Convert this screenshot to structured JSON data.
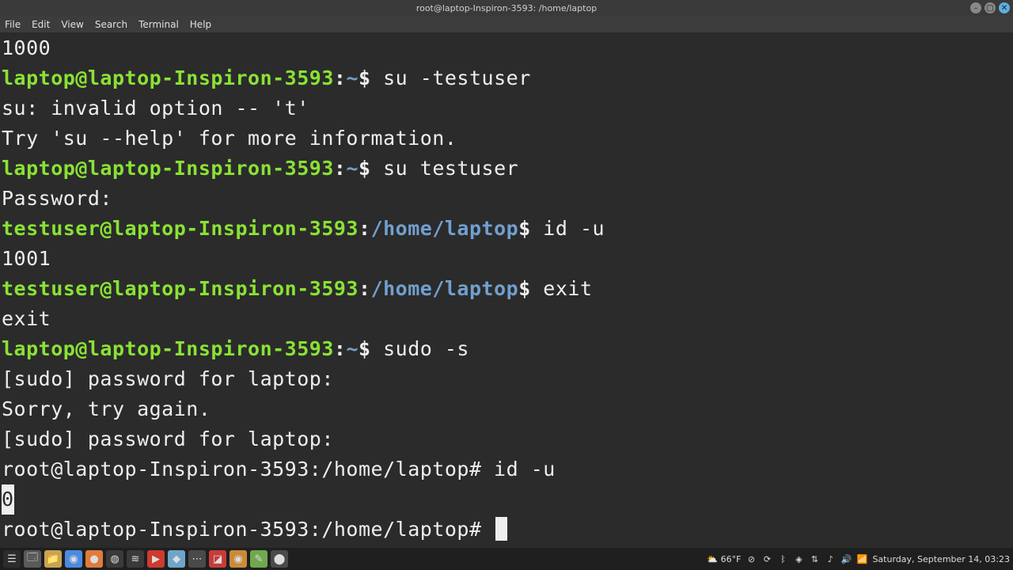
{
  "window": {
    "title": "root@laptop-Inspiron-3593: /home/laptop"
  },
  "menubar": [
    "File",
    "Edit",
    "View",
    "Search",
    "Terminal",
    "Help"
  ],
  "prompts": {
    "laptop_userhost": "laptop@laptop-Inspiron-3593",
    "laptop_home": "~",
    "laptop_sep1": ":",
    "laptop_sep2": "$",
    "testuser_userhost": "testuser@laptop-Inspiron-3593",
    "testuser_path": "/home/laptop",
    "root_full": "root@laptop-Inspiron-3593:/home/laptop#"
  },
  "lines": {
    "out_1000": "1000",
    "cmd_su_bad": " su -testuser",
    "err_su1": "su: invalid option -- 't'",
    "err_su2": "Try 'su --help' for more information.",
    "cmd_su_good": " su testuser",
    "password": "Password:",
    "cmd_idu": " id -u",
    "out_1001": "1001",
    "cmd_exit": " exit",
    "out_exit": "exit",
    "cmd_sudos": " sudo -s",
    "sudo_pw": "[sudo] password for laptop:",
    "sorry": "Sorry, try again.",
    "root_idu": " id -u",
    "out_0": "0",
    "root_empty": " "
  },
  "taskbar_icons": [
    {
      "name": "menu-icon",
      "glyph": "☰",
      "bg": "#2c2c2c"
    },
    {
      "name": "files-icon",
      "glyph": "🗔",
      "bg": "#5a5a5a"
    },
    {
      "name": "folder-icon",
      "glyph": "📁",
      "bg": "#caa352"
    },
    {
      "name": "chrome-icon",
      "glyph": "◉",
      "bg": "#4b8be0"
    },
    {
      "name": "firefox-icon",
      "glyph": "●",
      "bg": "#e07b3c"
    },
    {
      "name": "steam-icon",
      "glyph": "◍",
      "bg": "#3a3a3a"
    },
    {
      "name": "spotify-icon",
      "glyph": "≋",
      "bg": "#3a3a3a"
    },
    {
      "name": "media-icon",
      "glyph": "▶",
      "bg": "#cc3b2e"
    },
    {
      "name": "discord-icon",
      "glyph": "◆",
      "bg": "#6ea5c9"
    },
    {
      "name": "code-icon",
      "glyph": "⋯",
      "bg": "#4a4a4a"
    },
    {
      "name": "app1-icon",
      "glyph": "◪",
      "bg": "#c53d3a"
    },
    {
      "name": "app2-icon",
      "glyph": "◉",
      "bg": "#c98b39"
    },
    {
      "name": "app3-icon",
      "glyph": "✎",
      "bg": "#6fa84f"
    },
    {
      "name": "mint-icon",
      "glyph": "⬤",
      "bg": "#4a4a4a"
    }
  ],
  "tray": {
    "weather": "⛅ 66°F",
    "datetime": "Saturday, September 14, 03:23"
  }
}
